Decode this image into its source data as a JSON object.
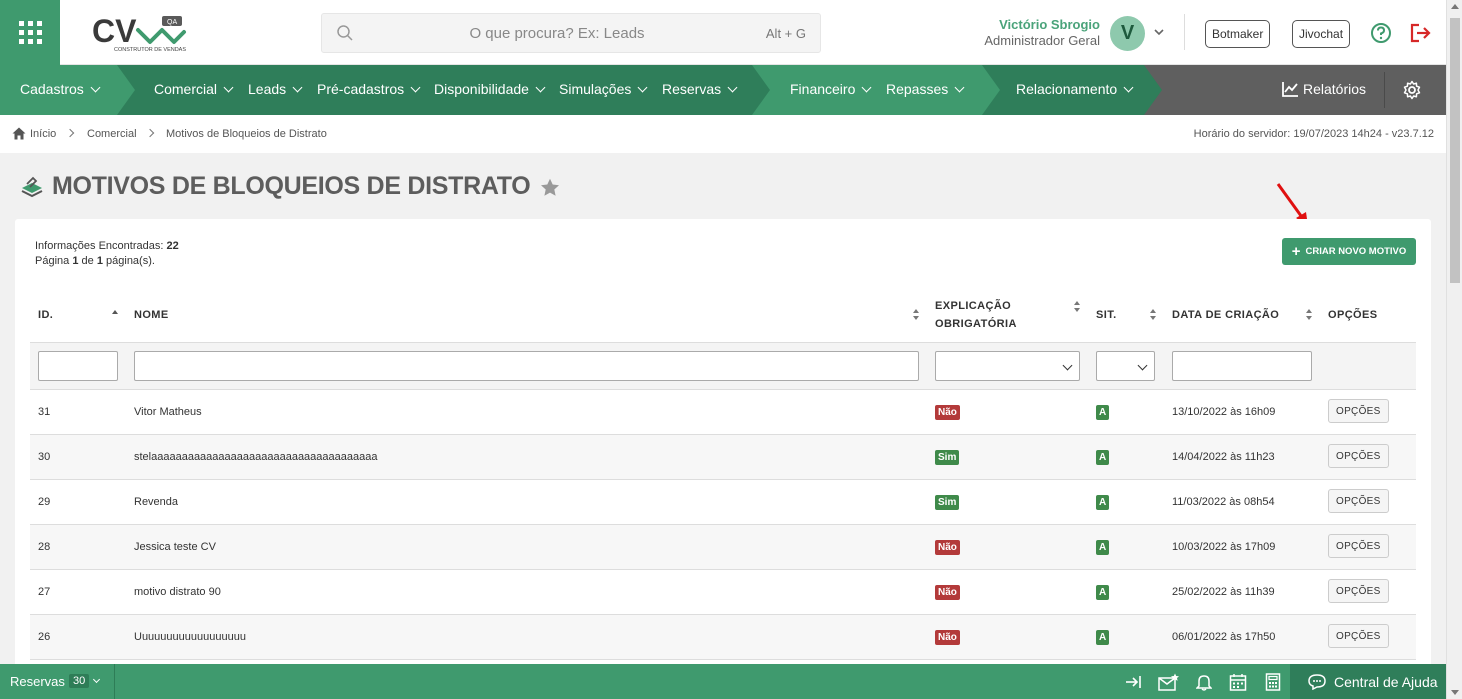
{
  "header": {
    "search_placeholder": "O que procura? Ex: Leads",
    "search_shortcut": "Alt + G",
    "user_name": "Victório Sbrogio",
    "user_role": "Administrador Geral",
    "avatar_letter": "V",
    "botmaker_label": "Botmaker",
    "jivochat_label": "Jivochat",
    "logo_text": "CV",
    "logo_sub": "CONSTRUTOR DE VENDAS",
    "logo_badge": "QA"
  },
  "nav": {
    "items": [
      {
        "label": "Cadastros"
      },
      {
        "label": "Comercial"
      },
      {
        "label": "Leads"
      },
      {
        "label": "Pré-cadastros"
      },
      {
        "label": "Disponibilidade"
      },
      {
        "label": "Simulações"
      },
      {
        "label": "Reservas"
      },
      {
        "label": "Financeiro"
      },
      {
        "label": "Repasses"
      },
      {
        "label": "Relacionamento"
      }
    ],
    "reports_label": "Relatórios"
  },
  "breadcrumb": {
    "home": "Início",
    "level1": "Comercial",
    "level2": "Motivos de Bloqueios de Distrato"
  },
  "server_time": "Horário do servidor: 19/07/2023 14h24 - v23.7.12",
  "page_title": "MOTIVOS DE BLOQUEIOS DE DISTRATO",
  "info": {
    "found_label": "Informações Encontradas:",
    "found_count": "22",
    "page_prefix": "Página",
    "page_current": "1",
    "page_of": "de",
    "page_total": "1",
    "page_suffix": "página(s)."
  },
  "create_button": "CRIAR NOVO MOTIVO",
  "table": {
    "headers": {
      "id": "ID.",
      "nome": "NOME",
      "explicacao_1": "EXPLICAÇÃO",
      "explicacao_2": "OBRIGATÓRIA",
      "sit": "SIT.",
      "data": "DATA DE CRIAÇÃO",
      "opcoes": "OPÇÕES"
    },
    "rows": [
      {
        "id": "31",
        "nome": "Vitor Matheus",
        "explicacao": "Não",
        "sit": "A",
        "data": "13/10/2022 às 16h09",
        "opcoes": "OPÇÕES"
      },
      {
        "id": "30",
        "nome": "stelaaaaaaaaaaaaaaaaaaaaaaaaaaaaaaaaaaaaa",
        "explicacao": "Sim",
        "sit": "A",
        "data": "14/04/2022 às 11h23",
        "opcoes": "OPÇÕES"
      },
      {
        "id": "29",
        "nome": "Revenda",
        "explicacao": "Sim",
        "sit": "A",
        "data": "11/03/2022 às 08h54",
        "opcoes": "OPÇÕES"
      },
      {
        "id": "28",
        "nome": "Jessica teste CV",
        "explicacao": "Não",
        "sit": "A",
        "data": "10/03/2022 às 17h09",
        "opcoes": "OPÇÕES"
      },
      {
        "id": "27",
        "nome": "motivo distrato 90",
        "explicacao": "Não",
        "sit": "A",
        "data": "25/02/2022 às 11h39",
        "opcoes": "OPÇÕES"
      },
      {
        "id": "26",
        "nome": "Uuuuuuuuuuuuuuuuuu",
        "explicacao": "Não",
        "sit": "A",
        "data": "06/01/2022 às 17h50",
        "opcoes": "OPÇÕES"
      }
    ]
  },
  "footer": {
    "reservas_label": "Reservas",
    "reservas_count": "30",
    "help_label": "Central de Ajuda"
  },
  "colors": {
    "brand_green": "#3f9a6e",
    "nav_gray": "#5f5f5f",
    "badge_no": "#b33a3a",
    "badge_yes": "#3f8a4a"
  }
}
